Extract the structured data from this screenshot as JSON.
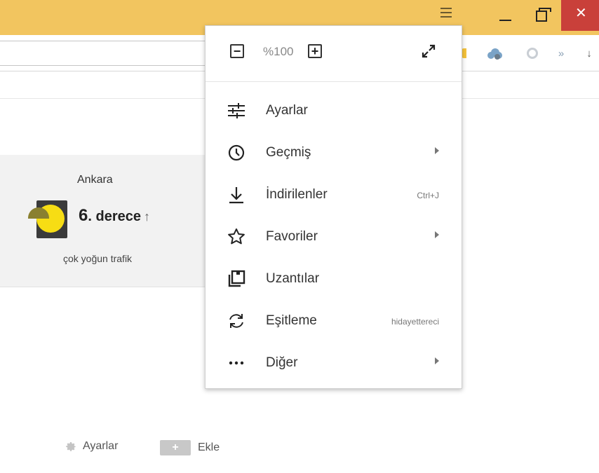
{
  "menu": {
    "zoom": {
      "minus": "−",
      "value": "%100",
      "plus": "+"
    },
    "items": [
      {
        "label": "Ayarlar",
        "icon": "sliders-icon"
      },
      {
        "label": "Geçmiş",
        "icon": "clock-icon",
        "submenu": true
      },
      {
        "label": "İndirilenler",
        "icon": "download-icon",
        "shortcut": "Ctrl+J"
      },
      {
        "label": "Favoriler",
        "icon": "star-icon",
        "submenu": true
      },
      {
        "label": "Uzantılar",
        "icon": "extensions-icon"
      },
      {
        "label": "Eşitleme",
        "icon": "sync-icon",
        "account": "hidayettereci"
      },
      {
        "label": "Diğer",
        "icon": "more-icon",
        "submenu": true
      }
    ]
  },
  "window": {
    "close": "✕"
  },
  "toolbar": {
    "overflow": "»",
    "download": "↓"
  },
  "weather": {
    "city": "Ankara",
    "temp": "6",
    "unit": ". derece",
    "trend": "↑",
    "traffic": "çok yoğun trafik"
  },
  "bottom": {
    "settings": "Ayarlar",
    "add_symbol": "+",
    "add": "Ekle"
  },
  "colors": {
    "titlebar": "#f2c55f",
    "close": "#c9403a"
  }
}
